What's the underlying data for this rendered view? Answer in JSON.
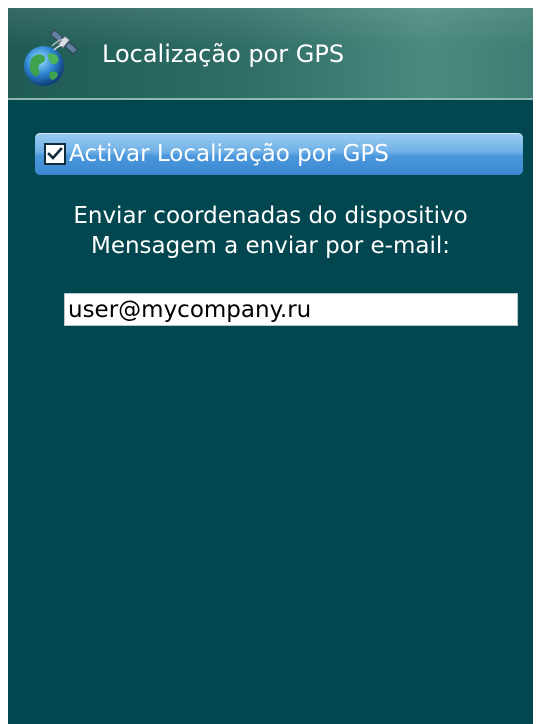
{
  "header": {
    "title": "Localização por GPS",
    "icon": "satellite-globe-icon"
  },
  "gps_toggle": {
    "label": "Activar Localização por GPS",
    "checked": true
  },
  "description": {
    "line1": "Enviar coordenadas do dispositivo",
    "line2": "Mensagem a enviar por e-mail:"
  },
  "email": {
    "value": "user@mycompany.ru"
  },
  "colors": {
    "background": "#024750",
    "highlight": "#4a97dc",
    "text": "#ffffff"
  }
}
